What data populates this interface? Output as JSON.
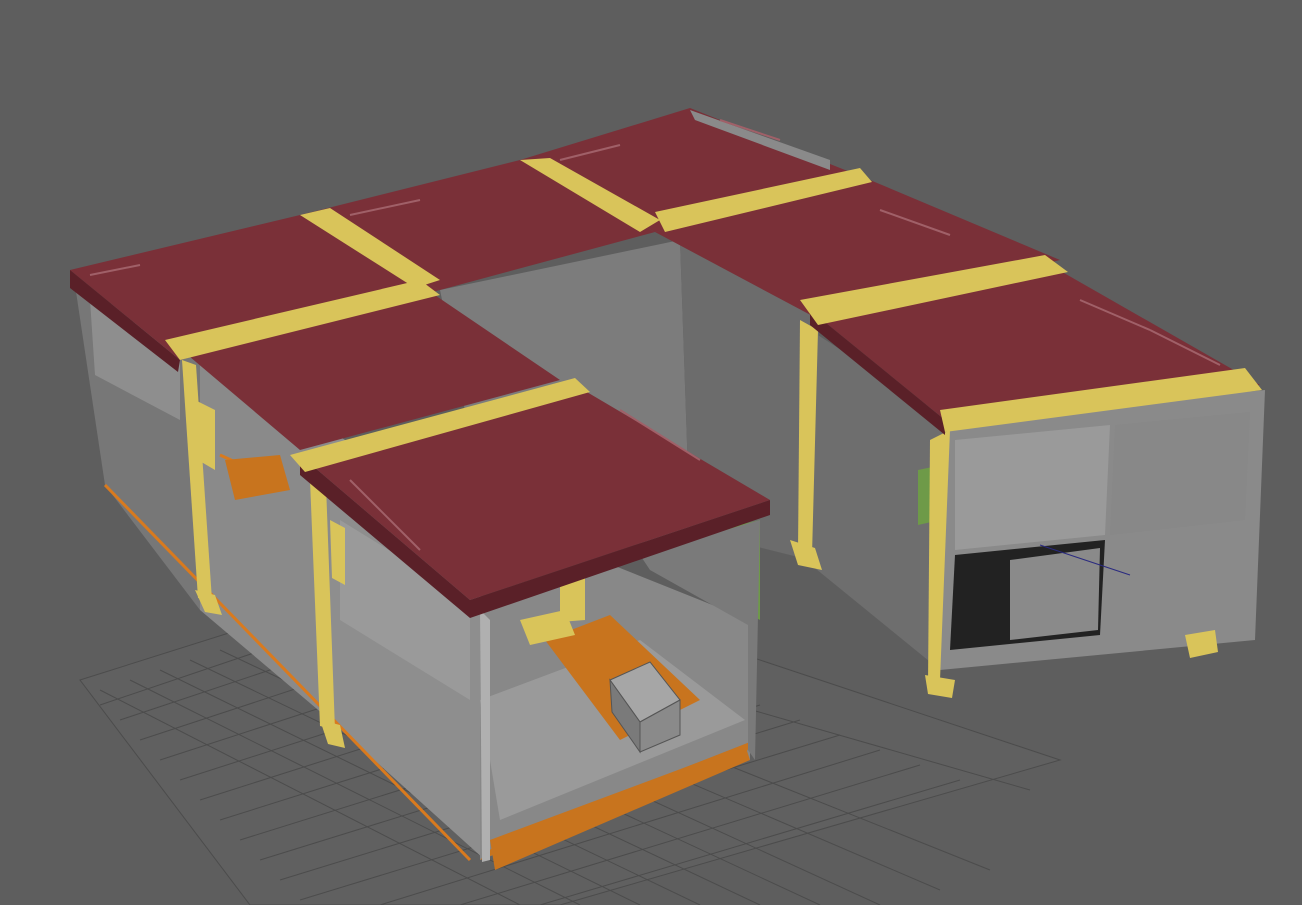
{
  "viewport": {
    "background": "#5e5e5e",
    "view": "perspective"
  },
  "colors": {
    "roof": "#7a3038",
    "roof_edge": "#5a2028",
    "beam": "#d9c45a",
    "beam_dark": "#b8a040",
    "wall_light": "#8e8e8e",
    "wall_mid": "#7a7a7a",
    "wall_dark": "#666666",
    "floor_orange": "#c8741e",
    "green_panel": "#6e9a48",
    "grid_line": "#4a4a4a"
  },
  "scene": {
    "objects": [
      "container-roof-left",
      "container-roof-front",
      "container-roof-middle",
      "container-roof-back",
      "container-roof-right",
      "support-beams",
      "interior-walls",
      "orange-floor",
      "green-panel",
      "storage-box"
    ]
  }
}
